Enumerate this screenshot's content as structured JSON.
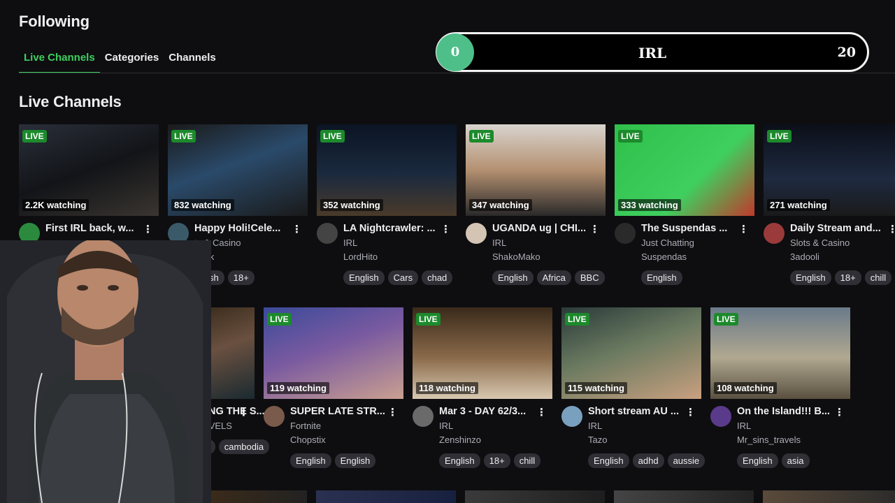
{
  "header": {
    "title": "Following",
    "tabs": [
      {
        "label": "Live Channels",
        "active": true
      },
      {
        "label": "Categories",
        "active": false
      },
      {
        "label": "Channels",
        "active": false
      }
    ]
  },
  "progress": {
    "value": "0",
    "label": "IRL",
    "max": "20",
    "fill_fraction": 0.0,
    "knob_color": "#4fbf8a"
  },
  "section": {
    "title": "Live Channels"
  },
  "colors": {
    "accent": "#3ecf5f",
    "live_badge": "#1c8a2c",
    "tag_bg": "#2f2f35"
  },
  "cards": [
    {
      "viewers": "2.2K watching",
      "title": "First IRL back, w...",
      "category": "",
      "streamer": "",
      "tags": [],
      "live": "LIVE"
    },
    {
      "viewers": "832 watching",
      "title": "Happy Holi!Cele...",
      "category": "ts & Casino",
      "streamer": "epak",
      "tags": [
        "glish",
        "18+"
      ],
      "live": "LIVE"
    },
    {
      "viewers": "352 watching",
      "title": "LA Nightcrawler: ...",
      "category": "IRL",
      "streamer": "LordHito",
      "tags": [
        "English",
        "Cars",
        "chad"
      ],
      "live": "LIVE"
    },
    {
      "viewers": "347 watching",
      "title": "UGANDA ug | CHI...",
      "category": "IRL",
      "streamer": "ShakoMako",
      "tags": [
        "English",
        "Africa",
        "BBC"
      ],
      "live": "LIVE"
    },
    {
      "viewers": "333 watching",
      "title": "The Suspendas ...",
      "category": "Just Chatting",
      "streamer": "Suspendas",
      "tags": [
        "English"
      ],
      "live": "LIVE"
    },
    {
      "viewers": "271 watching",
      "title": "Daily Stream and...",
      "category": "Slots & Casino",
      "streamer": "3adooli",
      "tags": [
        "English",
        "18+",
        "chill"
      ],
      "live": "LIVE"
    },
    {
      "viewers": "ning",
      "title": "ESSING THE S...",
      "category": "",
      "streamer": "STRAVELS",
      "tags": [
        "glish",
        "cambodia"
      ],
      "live": ""
    },
    {
      "viewers": "119 watching",
      "title": "SUPER LATE STR...",
      "category": "Fortnite",
      "streamer": "Chopstix",
      "tags": [
        "English",
        "English"
      ],
      "live": "LIVE"
    },
    {
      "viewers": "118 watching",
      "title": "Mar 3 - DAY 62/3...",
      "category": "IRL",
      "streamer": "Zenshinzo",
      "tags": [
        "English",
        "18+",
        "chill"
      ],
      "live": "LIVE"
    },
    {
      "viewers": "115 watching",
      "title": "Short stream AU ...",
      "category": "IRL",
      "streamer": "Tazo",
      "tags": [
        "English",
        "adhd",
        "aussie"
      ],
      "live": "LIVE"
    },
    {
      "viewers": "108 watching",
      "title": "On the Island!!! B...",
      "category": "IRL",
      "streamer": "Mr_sins_travels",
      "tags": [
        "English",
        "asia"
      ],
      "live": "LIVE"
    }
  ],
  "more_icon": "vertical-ellipsis",
  "more_glyph": "⋮"
}
